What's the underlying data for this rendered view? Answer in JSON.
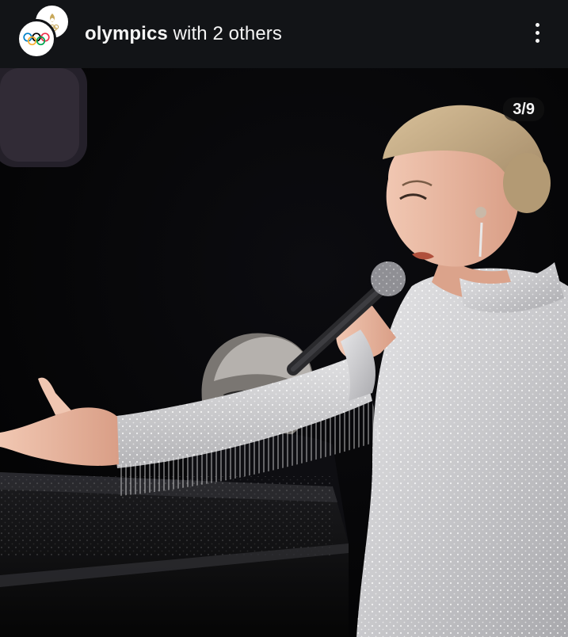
{
  "header": {
    "account_name": "olympics",
    "collab_suffix": " with 2 others",
    "avatars": [
      "paris-2024-logo",
      "olympic-rings-logo"
    ],
    "more_icon": "more-vertical-icon"
  },
  "media": {
    "counter": "3/9",
    "description": ""
  },
  "colors": {
    "header_bg": "#121417",
    "text": "#f5f5f5",
    "olympic_blue": "#0081c8",
    "olympic_yellow": "#fcb131",
    "olympic_black": "#000000",
    "olympic_green": "#00a651",
    "olympic_red": "#ee334e",
    "paris_gold": "#c8a85a"
  }
}
